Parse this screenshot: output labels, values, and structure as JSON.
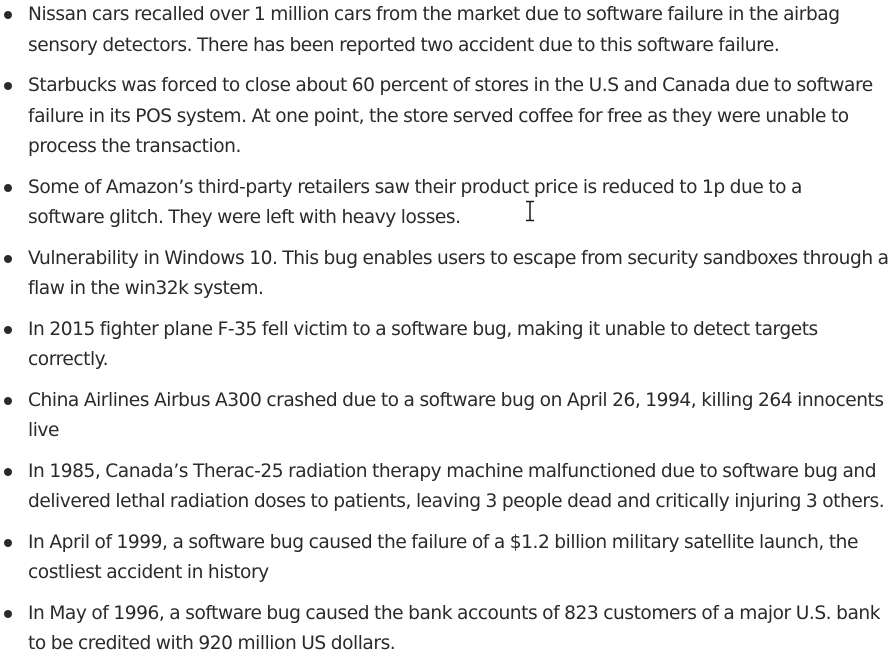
{
  "bullets": [
    {
      "lines": [
        "Nissan cars recalled over 1 million cars from the market due to software failure in the airbag",
        "sensory detectors. There has been reported two accident due to this software failure."
      ]
    },
    {
      "lines": [
        "Starbucks was forced to close about 60 percent of stores in the U.S and Canada due to software",
        "failure in its POS system. At one point, the store served coffee for free as they were unable to",
        "process the transaction."
      ]
    },
    {
      "lines": [
        "Some of Amazon’s third-party retailers saw their product price is reduced to 1p due to a",
        "software glitch. They were left with heavy losses."
      ]
    },
    {
      "lines": [
        "Vulnerability in Windows 10. This bug enables users to escape from security sandboxes through a",
        "flaw in the win32k system."
      ]
    },
    {
      "lines": [
        "In 2015 fighter plane F-35 fell victim to a software bug, making it unable to detect targets",
        "correctly."
      ]
    },
    {
      "lines": [
        "China Airlines Airbus A300 crashed due to a software bug on April 26, 1994, killing 264 innocents",
        "live"
      ]
    },
    {
      "lines": [
        "In 1985, Canada’s Therac-25 radiation therapy machine malfunctioned due to software bug and",
        "delivered lethal radiation doses to patients, leaving 3 people dead and critically injuring 3 others."
      ]
    },
    {
      "lines": [
        "In April of 1999, a software bug caused the failure of a $1.2 billion military satellite launch, the",
        "costliest accident in history"
      ]
    },
    {
      "lines": [
        "In May of 1996, a software bug caused the bank accounts of 823 customers of a major U.S. bank",
        "to be credited with 920 million US dollars."
      ]
    }
  ],
  "colors": {
    "text": "#2a2a2a",
    "background": "#ffffff"
  },
  "icons": {
    "cursor": "text-cursor-icon"
  }
}
